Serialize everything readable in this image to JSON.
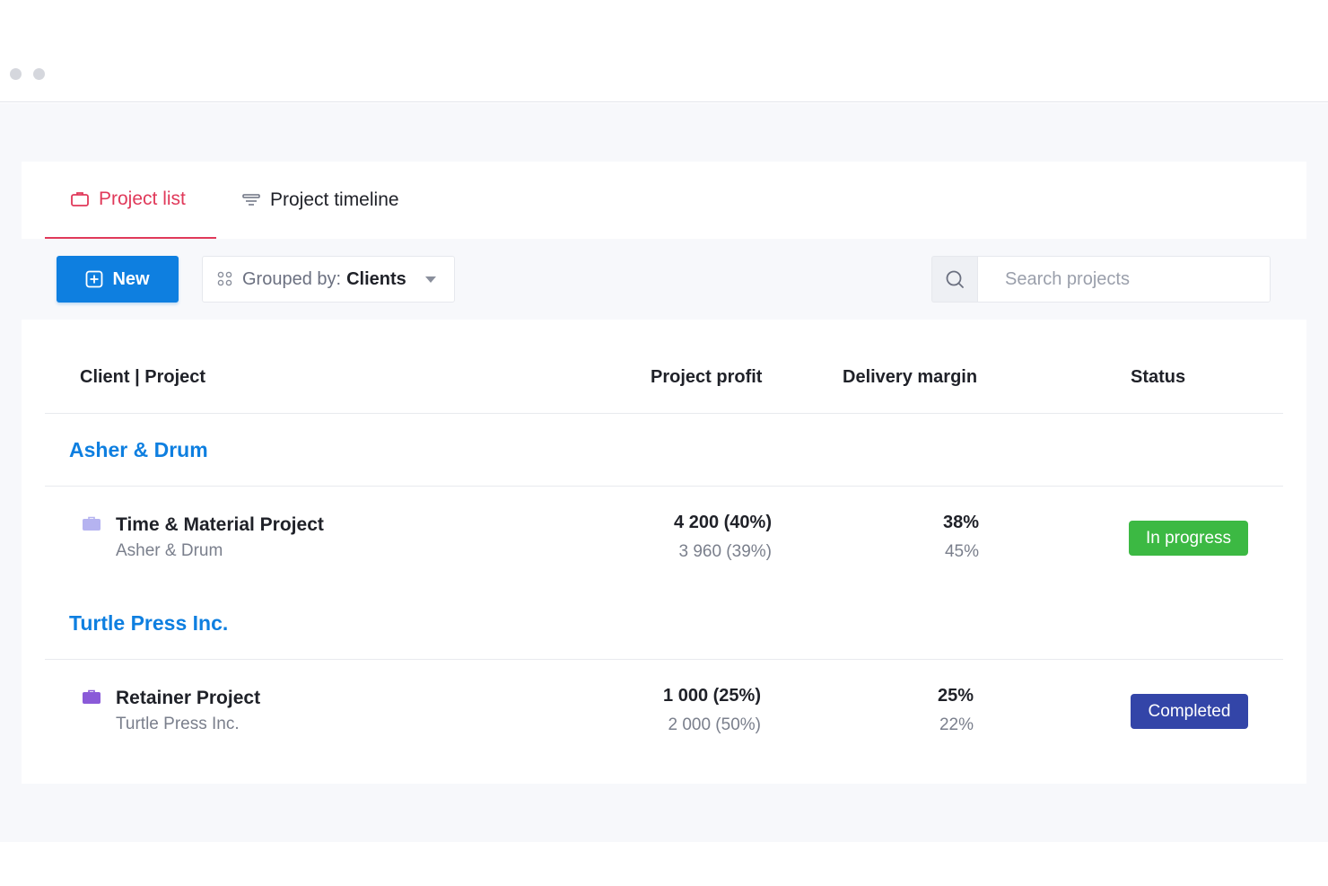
{
  "tabs": [
    {
      "label": "Project list",
      "icon": "briefcase-icon",
      "active": true
    },
    {
      "label": "Project timeline",
      "icon": "timeline-icon",
      "active": false
    }
  ],
  "toolbar": {
    "new_label": "New",
    "grouped_prefix": "Grouped by:",
    "grouped_value": "Clients",
    "search_placeholder": "Search projects"
  },
  "table": {
    "headers": {
      "client_project": "Client | Project",
      "profit": "Project profit",
      "margin": "Delivery margin",
      "status": "Status"
    },
    "groups": [
      {
        "client": "Asher & Drum",
        "projects": [
          {
            "name": "Time & Material Project",
            "client": "Asher & Drum",
            "profit_main": "4 200 (40%)",
            "profit_sub": "3 960 (39%)",
            "margin_main": "38%",
            "margin_sub": "45%",
            "status": "In progress",
            "status_color": "#3cb943",
            "icon_color": "#b5b3f0"
          }
        ]
      },
      {
        "client": "Turtle Press Inc.",
        "projects": [
          {
            "name": "Retainer Project",
            "client": "Turtle Press Inc.",
            "profit_main": "1 000 (25%)",
            "profit_sub": "2 000 (50%)",
            "margin_main": "25%",
            "margin_sub": "22%",
            "status": "Completed",
            "status_color": "#3345a8",
            "icon_color": "#8a5ad8"
          }
        ]
      }
    ]
  }
}
